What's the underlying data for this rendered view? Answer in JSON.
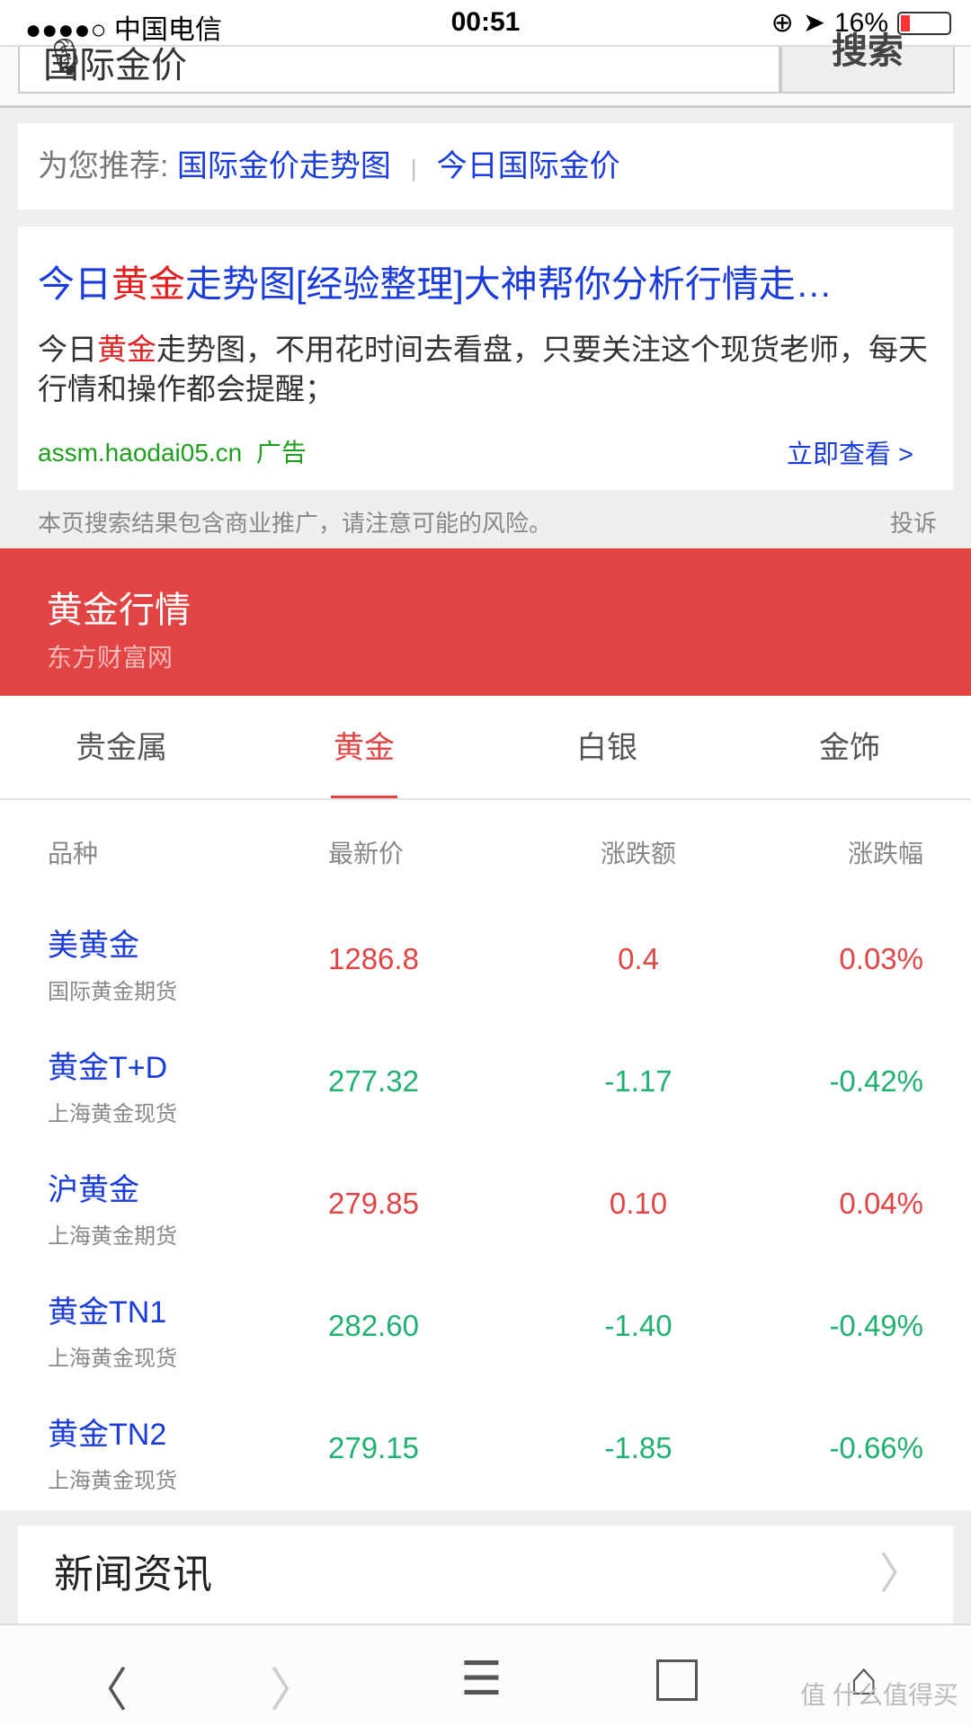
{
  "status": {
    "carrier": "●●●●○ 中国电信",
    "wifi_icon": "wifi-icon",
    "time": "00:51",
    "battery": "16%",
    "battery_level": 0.16
  },
  "search": {
    "value": "国际金价",
    "button": "搜索"
  },
  "recommend": {
    "label": "为您推荐:",
    "links": [
      "国际金价走势图",
      "今日国际金价"
    ]
  },
  "ad": {
    "title_pre": "今日",
    "title_hl": "黄金",
    "title_post": "走势图[经验整理]大神帮你分析行情走…",
    "desc_pre": "今日",
    "desc_hl": "黄金",
    "desc_post": "走势图，不用花时间去看盘，只要关注这个现货老师，每天行情和操作都会提醒；",
    "url": "assm.haodai05.cn",
    "tag": "广告",
    "view": "立即查看 >"
  },
  "disclaimer": "本页搜索结果包含商业推广，请注意可能的风险。",
  "report": "投诉",
  "section": {
    "title": "黄金行情",
    "source": "东方财富网"
  },
  "tabs": [
    "贵金属",
    "黄金",
    "白银",
    "金饰"
  ],
  "table": {
    "headers": [
      "品种",
      "最新价",
      "涨跌额",
      "涨跌幅"
    ],
    "rows": [
      {
        "name": "美黄金",
        "sub": "国际黄金期货",
        "price": "1286.8",
        "chg": "0.4",
        "pct": "0.03%",
        "dir": "up"
      },
      {
        "name": "黄金T+D",
        "sub": "上海黄金现货",
        "price": "277.32",
        "chg": "-1.17",
        "pct": "-0.42%",
        "dir": "dn"
      },
      {
        "name": "沪黄金",
        "sub": "上海黄金期货",
        "price": "279.85",
        "chg": "0.10",
        "pct": "0.04%",
        "dir": "up"
      },
      {
        "name": "黄金TN1",
        "sub": "上海黄金现货",
        "price": "282.60",
        "chg": "-1.40",
        "pct": "-0.49%",
        "dir": "dn"
      },
      {
        "name": "黄金TN2",
        "sub": "上海黄金现货",
        "price": "279.15",
        "chg": "-1.85",
        "pct": "-0.66%",
        "dir": "dn"
      }
    ]
  },
  "news": {
    "title": "新闻资讯"
  },
  "watermark": "值 什么值得买",
  "colors": {
    "accent": "#e24444",
    "up": "#e24444",
    "down": "#20b070",
    "link": "#1a3cdc"
  }
}
